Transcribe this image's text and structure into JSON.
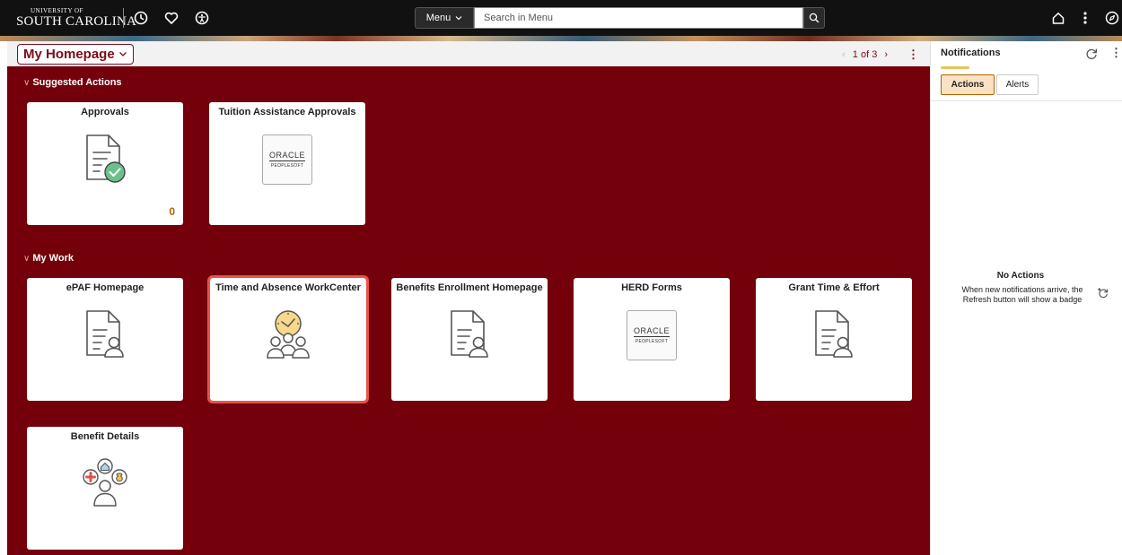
{
  "header": {
    "logo_small": "UNIVERSITY OF",
    "logo_big": "SOUTH CAROLINA",
    "menu_label": "Menu",
    "search_placeholder": "Search in Menu"
  },
  "homepage": {
    "selector_label": "My Homepage",
    "pager_text": "1 of 3"
  },
  "sections": {
    "suggested": {
      "title": "Suggested Actions",
      "tiles": [
        {
          "title": "Approvals",
          "icon": "document-check-icon",
          "count": "0"
        },
        {
          "title": "Tuition Assistance Approvals",
          "icon": "oracle-peoplesoft-logo"
        }
      ]
    },
    "my_work": {
      "title": "My Work",
      "tiles": [
        {
          "title": "ePAF Homepage",
          "icon": "document-person-icon"
        },
        {
          "title": "Time and Absence WorkCenter",
          "icon": "clock-people-icon",
          "selected": true
        },
        {
          "title": "Benefits Enrollment Homepage",
          "icon": "document-person-icon"
        },
        {
          "title": "HERD Forms",
          "icon": "oracle-peoplesoft-logo"
        },
        {
          "title": "Grant Time & Effort",
          "icon": "document-person-icon"
        },
        {
          "title": "Benefit Details",
          "icon": "benefits-person-icon"
        }
      ]
    }
  },
  "oracle_logo": {
    "line1": "ORACLE",
    "line2": "PEOPLESOFT"
  },
  "notifications": {
    "title": "Notifications",
    "tab_actions": "Actions",
    "tab_alerts": "Alerts",
    "empty_title": "No Actions",
    "empty_message": "When new notifications arrive, the Refresh button will show a badge"
  },
  "colors": {
    "maroon": "#73000b",
    "accent_orange": "#b06400",
    "selected_outline": "#e8534a"
  }
}
